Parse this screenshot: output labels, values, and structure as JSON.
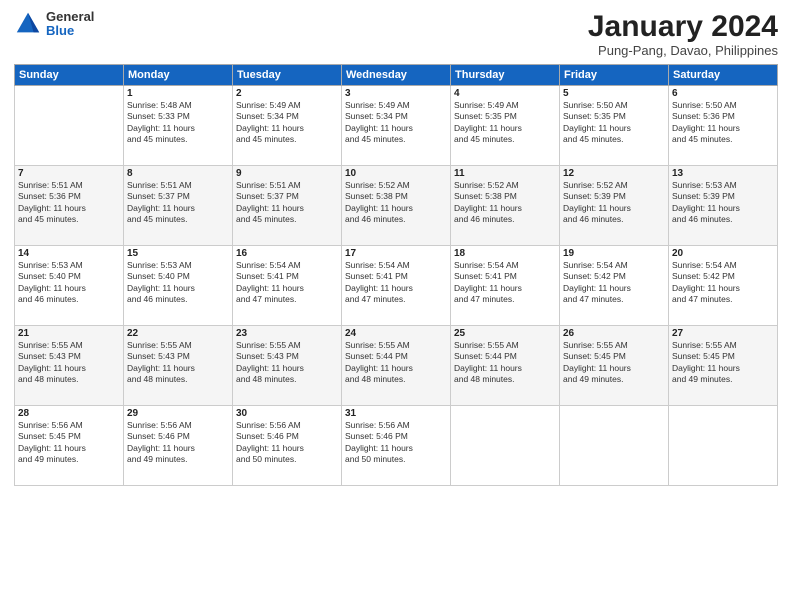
{
  "header": {
    "logo_general": "General",
    "logo_blue": "Blue",
    "title": "January 2024",
    "location": "Pung-Pang, Davao, Philippines"
  },
  "days_of_week": [
    "Sunday",
    "Monday",
    "Tuesday",
    "Wednesday",
    "Thursday",
    "Friday",
    "Saturday"
  ],
  "weeks": [
    [
      {
        "day": "",
        "info": ""
      },
      {
        "day": "1",
        "info": "Sunrise: 5:48 AM\nSunset: 5:33 PM\nDaylight: 11 hours\nand 45 minutes."
      },
      {
        "day": "2",
        "info": "Sunrise: 5:49 AM\nSunset: 5:34 PM\nDaylight: 11 hours\nand 45 minutes."
      },
      {
        "day": "3",
        "info": "Sunrise: 5:49 AM\nSunset: 5:34 PM\nDaylight: 11 hours\nand 45 minutes."
      },
      {
        "day": "4",
        "info": "Sunrise: 5:49 AM\nSunset: 5:35 PM\nDaylight: 11 hours\nand 45 minutes."
      },
      {
        "day": "5",
        "info": "Sunrise: 5:50 AM\nSunset: 5:35 PM\nDaylight: 11 hours\nand 45 minutes."
      },
      {
        "day": "6",
        "info": "Sunrise: 5:50 AM\nSunset: 5:36 PM\nDaylight: 11 hours\nand 45 minutes."
      }
    ],
    [
      {
        "day": "7",
        "info": "Sunrise: 5:51 AM\nSunset: 5:36 PM\nDaylight: 11 hours\nand 45 minutes."
      },
      {
        "day": "8",
        "info": "Sunrise: 5:51 AM\nSunset: 5:37 PM\nDaylight: 11 hours\nand 45 minutes."
      },
      {
        "day": "9",
        "info": "Sunrise: 5:51 AM\nSunset: 5:37 PM\nDaylight: 11 hours\nand 45 minutes."
      },
      {
        "day": "10",
        "info": "Sunrise: 5:52 AM\nSunset: 5:38 PM\nDaylight: 11 hours\nand 46 minutes."
      },
      {
        "day": "11",
        "info": "Sunrise: 5:52 AM\nSunset: 5:38 PM\nDaylight: 11 hours\nand 46 minutes."
      },
      {
        "day": "12",
        "info": "Sunrise: 5:52 AM\nSunset: 5:39 PM\nDaylight: 11 hours\nand 46 minutes."
      },
      {
        "day": "13",
        "info": "Sunrise: 5:53 AM\nSunset: 5:39 PM\nDaylight: 11 hours\nand 46 minutes."
      }
    ],
    [
      {
        "day": "14",
        "info": "Sunrise: 5:53 AM\nSunset: 5:40 PM\nDaylight: 11 hours\nand 46 minutes."
      },
      {
        "day": "15",
        "info": "Sunrise: 5:53 AM\nSunset: 5:40 PM\nDaylight: 11 hours\nand 46 minutes."
      },
      {
        "day": "16",
        "info": "Sunrise: 5:54 AM\nSunset: 5:41 PM\nDaylight: 11 hours\nand 47 minutes."
      },
      {
        "day": "17",
        "info": "Sunrise: 5:54 AM\nSunset: 5:41 PM\nDaylight: 11 hours\nand 47 minutes."
      },
      {
        "day": "18",
        "info": "Sunrise: 5:54 AM\nSunset: 5:41 PM\nDaylight: 11 hours\nand 47 minutes."
      },
      {
        "day": "19",
        "info": "Sunrise: 5:54 AM\nSunset: 5:42 PM\nDaylight: 11 hours\nand 47 minutes."
      },
      {
        "day": "20",
        "info": "Sunrise: 5:54 AM\nSunset: 5:42 PM\nDaylight: 11 hours\nand 47 minutes."
      }
    ],
    [
      {
        "day": "21",
        "info": "Sunrise: 5:55 AM\nSunset: 5:43 PM\nDaylight: 11 hours\nand 48 minutes."
      },
      {
        "day": "22",
        "info": "Sunrise: 5:55 AM\nSunset: 5:43 PM\nDaylight: 11 hours\nand 48 minutes."
      },
      {
        "day": "23",
        "info": "Sunrise: 5:55 AM\nSunset: 5:43 PM\nDaylight: 11 hours\nand 48 minutes."
      },
      {
        "day": "24",
        "info": "Sunrise: 5:55 AM\nSunset: 5:44 PM\nDaylight: 11 hours\nand 48 minutes."
      },
      {
        "day": "25",
        "info": "Sunrise: 5:55 AM\nSunset: 5:44 PM\nDaylight: 11 hours\nand 48 minutes."
      },
      {
        "day": "26",
        "info": "Sunrise: 5:55 AM\nSunset: 5:45 PM\nDaylight: 11 hours\nand 49 minutes."
      },
      {
        "day": "27",
        "info": "Sunrise: 5:55 AM\nSunset: 5:45 PM\nDaylight: 11 hours\nand 49 minutes."
      }
    ],
    [
      {
        "day": "28",
        "info": "Sunrise: 5:56 AM\nSunset: 5:45 PM\nDaylight: 11 hours\nand 49 minutes."
      },
      {
        "day": "29",
        "info": "Sunrise: 5:56 AM\nSunset: 5:46 PM\nDaylight: 11 hours\nand 49 minutes."
      },
      {
        "day": "30",
        "info": "Sunrise: 5:56 AM\nSunset: 5:46 PM\nDaylight: 11 hours\nand 50 minutes."
      },
      {
        "day": "31",
        "info": "Sunrise: 5:56 AM\nSunset: 5:46 PM\nDaylight: 11 hours\nand 50 minutes."
      },
      {
        "day": "",
        "info": ""
      },
      {
        "day": "",
        "info": ""
      },
      {
        "day": "",
        "info": ""
      }
    ]
  ]
}
